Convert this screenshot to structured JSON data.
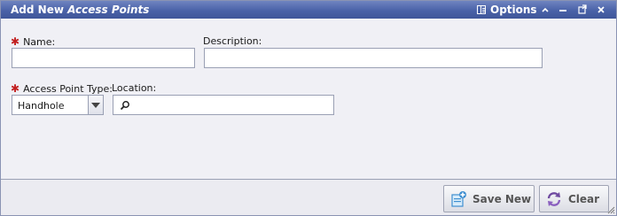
{
  "window": {
    "title_prefix": "Add New",
    "title_italic": "Access Points",
    "options_label": "Options"
  },
  "form": {
    "name_label": "Name:",
    "name_value": "",
    "description_label": "Description:",
    "description_value": "",
    "type_label": "Access Point Type:",
    "type_value": "Handhole",
    "location_label": "Location:",
    "location_value": "",
    "required_marker": "✱"
  },
  "footer": {
    "save_new_label": "Save New",
    "clear_label": "Clear"
  },
  "colors": {
    "titlebar": "#4a62a8",
    "required": "#c22020",
    "save_icon": "#3f8fd0",
    "clear_icon": "#6f4aa0"
  }
}
